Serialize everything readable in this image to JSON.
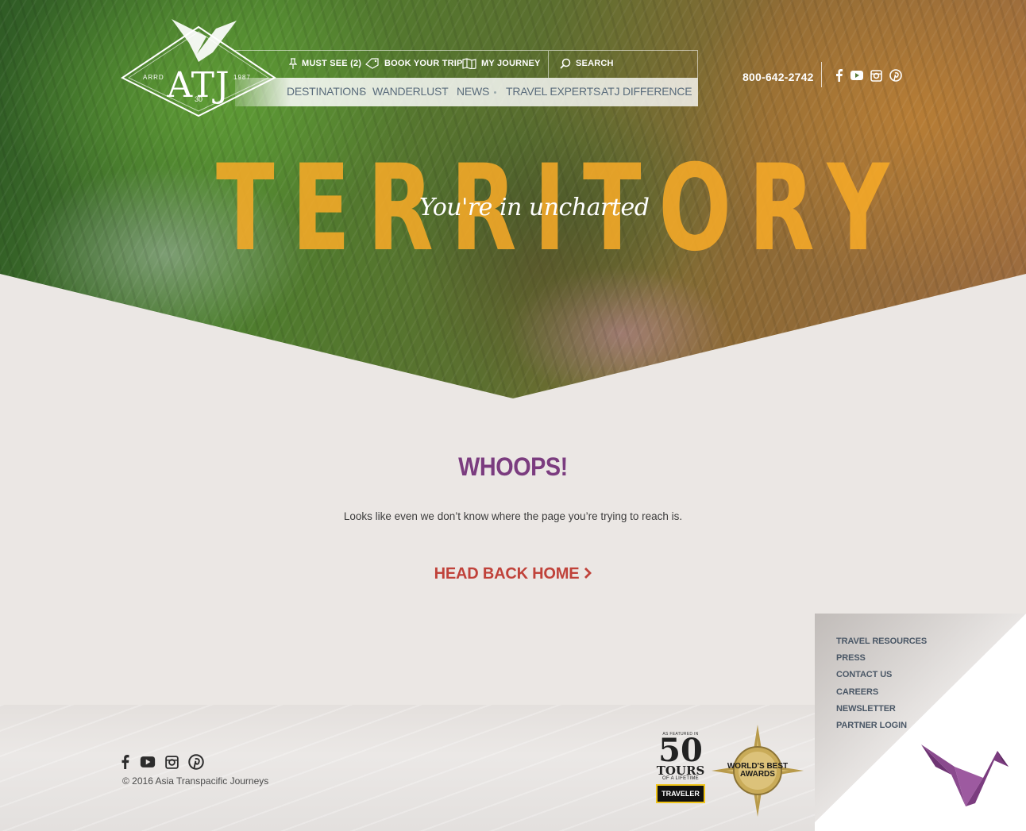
{
  "logo": {
    "text": "ATJ",
    "left": "ARRD",
    "right": "1987",
    "bottom": "30"
  },
  "nav_top": {
    "must_see": "MUST SEE (2)",
    "book_trip": "BOOK YOUR TRIP",
    "my_journey": "MY JOURNEY",
    "search_placeholder": "SEARCH"
  },
  "nav_main": {
    "items": [
      "DESTINATIONS",
      "WANDERLUST",
      "NEWS",
      "TRAVEL EXPERTS",
      "ATJ DIFFERENCE"
    ]
  },
  "header": {
    "phone": "800-642-2742",
    "social": [
      "facebook-icon",
      "youtube-icon",
      "instagram-icon",
      "pinterest-icon"
    ]
  },
  "hero": {
    "big_word": "TERRITORY",
    "script": "You're in uncharted"
  },
  "error": {
    "title": "WHOOPS!",
    "message": "Looks like even we don’t know where the page you’re trying to reach is.",
    "link": "HEAD BACK HOME"
  },
  "footer": {
    "copyright": "© 2016 Asia Transpacific Journeys",
    "links": [
      "TRAVEL RESOURCES",
      "PRESS",
      "CONTACT US",
      "CAREERS",
      "NEWSLETTER",
      "PARTNER LOGIN"
    ],
    "badge_50": {
      "featured": "AS FEATURED IN",
      "number": "50",
      "tours": "TOURS",
      "lifetime": "OF A LIFETIME",
      "brand": "TRAVELER"
    },
    "award": "WORLD'S BEST AWARDS"
  },
  "colors": {
    "accent_purple": "#7b3c7f",
    "accent_red": "#c0423a",
    "hero_orange": "#f6aa28",
    "nav_text": "#5a6c7c"
  }
}
